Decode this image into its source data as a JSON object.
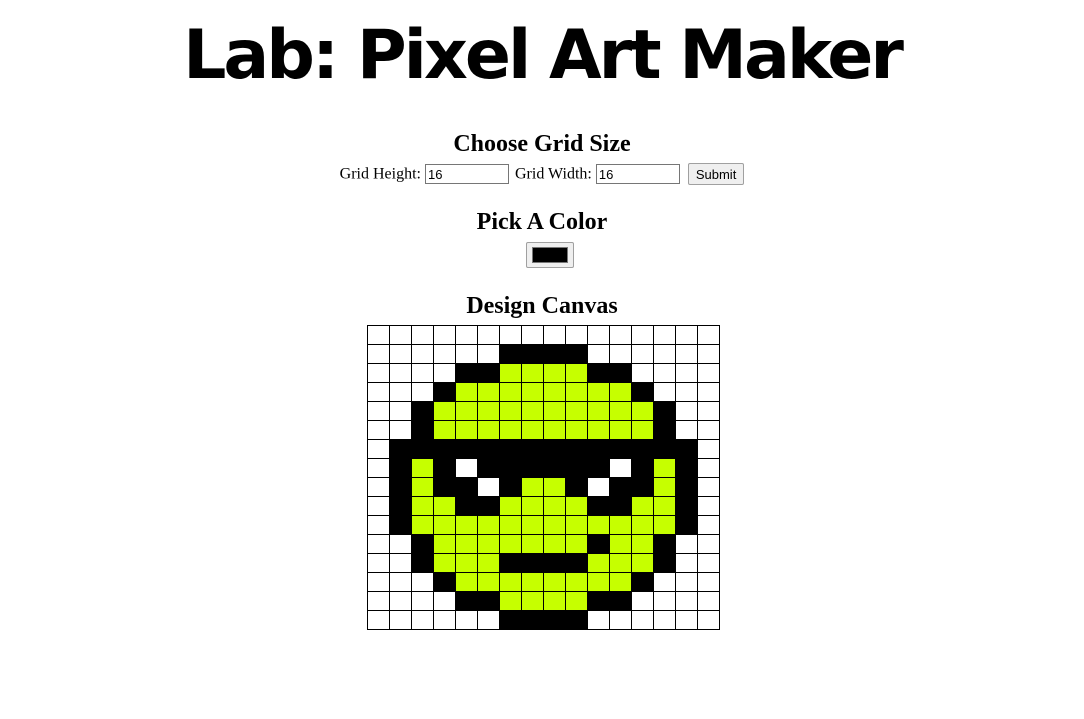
{
  "title": "Lab: Pixel Art Maker",
  "grid_form": {
    "heading": "Choose Grid Size",
    "height_label": "Grid Height:",
    "height_value": "16",
    "width_label": "Grid Width:",
    "width_value": "16",
    "submit_label": "Submit"
  },
  "color_picker": {
    "heading": "Pick A Color",
    "value": "#000000"
  },
  "canvas": {
    "heading": "Design Canvas",
    "rows": 16,
    "cols": 16,
    "palette": {
      ".": "#ffffff",
      "K": "#000000",
      "G": "#c6ff00"
    },
    "pixels": [
      "................",
      "......KKKK......",
      "....KKGGGGKK....",
      "...KGGGGGGGGK...",
      "..KGGGGGGGGGGK..",
      "..KGGGGGGGGGGK..",
      ".KKKKKKKKKKKKKK.",
      ".KGK.KKKKKK.KGK.",
      ".KGKK.KGGK.KKGK.",
      ".KGGKKGGGGKKGGK.",
      ".KGGGGGGGGGGGGK.",
      "..KGGGGGGGKGGK..",
      "..KGGGKKKKGGGK..",
      "...KGGGGGGGGK...",
      "....KKGGGGKK....",
      "......KKKK......"
    ]
  }
}
